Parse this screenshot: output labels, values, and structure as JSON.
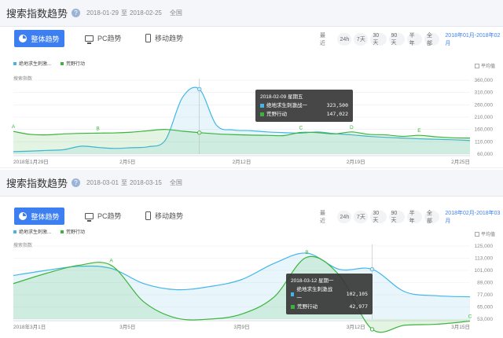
{
  "colors": {
    "series_a": "#42b6e8",
    "series_b": "#3cb43c",
    "accent": "#3d7ff0"
  },
  "panels": [
    {
      "title": "搜索指数趋势",
      "help": "?",
      "date_from": "2018-01-29",
      "date_sep": "至",
      "date_to": "2018-02-25",
      "region": "全国",
      "tabs": {
        "overall": "整体趋势",
        "pc": "PC趋势",
        "mobile": "移动趋势"
      },
      "range_label": "最近",
      "ranges": [
        "24h",
        "7天",
        "30天",
        "90天",
        "半年",
        "全部"
      ],
      "range_span": "2018年01月-2018年02月",
      "legend": [
        "绝地求生刺激...",
        "荒野行动"
      ],
      "avg_label": "平均值",
      "y_title": "搜索指数",
      "watermark": "百度指数 index.baidu.com",
      "tooltip": {
        "date": "2018-02-09 星期五",
        "rows": [
          {
            "name": "绝地求生刺激战一",
            "value": "323,500"
          },
          {
            "name": "荒野行动",
            "value": "147,022"
          }
        ]
      },
      "chart_data": {
        "type": "line",
        "x_ticks": [
          "2018年1月29日",
          "2月5日",
          "2月12日",
          "2月19日",
          "2月25日"
        ],
        "y_ticks": [
          "360,000",
          "310,000",
          "260,000",
          "210,000",
          "160,000",
          "110,000",
          "60,000"
        ],
        "ylim": [
          60000,
          360000
        ],
        "days": 28,
        "highlight_day": 11,
        "annotations": [
          "A",
          "B",
          "C",
          "D",
          "E"
        ],
        "annotation_days": [
          0,
          5,
          17,
          20,
          24
        ],
        "series": [
          {
            "name": "绝地求生刺激战一",
            "values": [
              70000,
              72000,
              75000,
              78000,
              92000,
              87000,
              83000,
              86000,
              90000,
              118000,
              290000,
              323500,
              178000,
              158000,
              155000,
              150000,
              147000,
              145000,
              150000,
              143000,
              138000,
              132000,
              128000,
              125000,
              122000,
              120000,
              118000,
              115000
            ]
          },
          {
            "name": "荒野行动",
            "values": [
              152000,
              140000,
              138000,
              142000,
              144000,
              145000,
              146000,
              149000,
              155000,
              160000,
              153000,
              147022,
              142000,
              139000,
              137000,
              136000,
              135000,
              148000,
              147000,
              142000,
              150000,
              140000,
              138000,
              132000,
              136000,
              130000,
              126000,
              125000
            ]
          }
        ]
      }
    },
    {
      "title": "搜索指数趋势",
      "help": "?",
      "date_from": "2018-03-01",
      "date_sep": "至",
      "date_to": "2018-03-15",
      "region": "全国",
      "tabs": {
        "overall": "整体趋势",
        "pc": "PC趋势",
        "mobile": "移动趋势"
      },
      "range_label": "最近",
      "ranges": [
        "24h",
        "7天",
        "30天",
        "90天",
        "半年",
        "全部"
      ],
      "range_span": "2018年02月-2018年03月",
      "legend": [
        "绝地求生刺激...",
        "荒野行动"
      ],
      "avg_label": "平均值",
      "y_title": "搜索指数",
      "watermark": "百度指数 index.baidu.com",
      "tooltip": {
        "date": "2018-03-12 星期一",
        "rows": [
          {
            "name": "绝地求生刺激战一",
            "value": "102,105"
          },
          {
            "name": "荒野行动",
            "value": "42,977"
          }
        ]
      },
      "chart_data": {
        "type": "line",
        "x_ticks": [
          "2018年3月1日",
          "3月5日",
          "3月9日",
          "3月12日",
          "3月15日"
        ],
        "y_ticks": [
          "125,000",
          "113,000",
          "101,000",
          "89,000",
          "77,000",
          "65,000",
          "53,000"
        ],
        "ylim": [
          53000,
          125000
        ],
        "days": 15,
        "highlight_day": 11,
        "annotations": [
          "A",
          "B",
          "C"
        ],
        "annotation_days": [
          3,
          9,
          14
        ],
        "series": [
          {
            "name": "绝地求生刺激战一",
            "values": [
              96000,
              101000,
              105000,
              103000,
              88000,
              82000,
              85000,
              92000,
              108000,
              118000,
              102000,
              102105,
              80000,
              76000,
              75000
            ]
          },
          {
            "name": "荒野行动",
            "values": [
              88000,
              98000,
              106000,
              106000,
              70000,
              54000,
              53000,
              58000,
              75000,
              114000,
              96000,
              42977,
              47000,
              48000,
              51000
            ]
          }
        ]
      }
    }
  ]
}
